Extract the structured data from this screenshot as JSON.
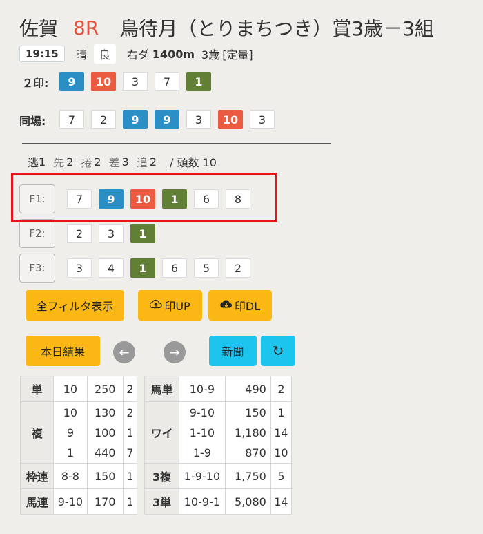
{
  "race": {
    "venue": "佐賀",
    "race_no": "8R",
    "name": "鳥待月（とりまちつき）賞3歳－3組",
    "time": "19:15",
    "weather": "晴",
    "condition": "良",
    "course": "右ダ",
    "distance": "1400m",
    "age": "3歳",
    "weight_rule": "[定量]"
  },
  "marks": {
    "label": "２印:",
    "numbers": [
      {
        "n": "9",
        "c": "blue"
      },
      {
        "n": "10",
        "c": "red"
      },
      {
        "n": "3",
        "c": "white"
      },
      {
        "n": "7",
        "c": "white"
      },
      {
        "n": "1",
        "c": "green"
      }
    ]
  },
  "same_venue": {
    "label": "同場:",
    "numbers": [
      {
        "n": "7",
        "c": "white"
      },
      {
        "n": "2",
        "c": "white"
      },
      {
        "n": "9",
        "c": "blue"
      },
      {
        "n": "9",
        "c": "blue"
      },
      {
        "n": "3",
        "c": "white"
      },
      {
        "n": "10",
        "c": "red"
      },
      {
        "n": "3",
        "c": "white"
      }
    ]
  },
  "running_style": {
    "nige_k": "逃",
    "nige_v": "1",
    "senko_k": "先",
    "senko_v": "2",
    "makuri_k": "捲",
    "makuri_v": "2",
    "sashi_k": "差",
    "sashi_v": "3",
    "oikomi_k": "追",
    "oikomi_v": "2",
    "count": "/ 頭数 10"
  },
  "filters": [
    {
      "label": "F1:",
      "numbers": [
        {
          "n": "7",
          "c": "white"
        },
        {
          "n": "9",
          "c": "blue"
        },
        {
          "n": "10",
          "c": "red"
        },
        {
          "n": "1",
          "c": "green"
        },
        {
          "n": "6",
          "c": "white"
        },
        {
          "n": "8",
          "c": "white"
        }
      ]
    },
    {
      "label": "F2:",
      "numbers": [
        {
          "n": "2",
          "c": "white"
        },
        {
          "n": "3",
          "c": "white"
        },
        {
          "n": "1",
          "c": "green"
        }
      ]
    },
    {
      "label": "F3:",
      "numbers": [
        {
          "n": "3",
          "c": "white"
        },
        {
          "n": "4",
          "c": "white"
        },
        {
          "n": "1",
          "c": "green"
        },
        {
          "n": "6",
          "c": "white"
        },
        {
          "n": "5",
          "c": "white"
        },
        {
          "n": "2",
          "c": "white"
        }
      ]
    }
  ],
  "buttons": {
    "show_all": "全フィルタ表示",
    "upload": "印UP",
    "upload_icon": "cloud-upload-icon",
    "download": "印DL",
    "download_icon": "cloud-download-icon",
    "results": "本日結果",
    "prev_icon": "←",
    "next_icon": "→",
    "newspaper": "新聞",
    "refresh_icon": "↻"
  },
  "payouts": {
    "left": [
      {
        "type": "単",
        "lines": [
          {
            "c": "10",
            "p": "250",
            "r": "2"
          }
        ]
      },
      {
        "type": "複",
        "lines": [
          {
            "c": "10",
            "p": "130",
            "r": "2"
          },
          {
            "c": "9",
            "p": "100",
            "r": "1"
          },
          {
            "c": "1",
            "p": "440",
            "r": "7"
          }
        ]
      },
      {
        "type": "枠連",
        "lines": [
          {
            "c": "8-8",
            "p": "150",
            "r": "1"
          }
        ]
      },
      {
        "type": "馬連",
        "lines": [
          {
            "c": "9-10",
            "p": "170",
            "r": "1"
          }
        ]
      }
    ],
    "right": [
      {
        "type": "馬単",
        "lines": [
          {
            "c": "10-9",
            "p": "490",
            "r": "2"
          }
        ]
      },
      {
        "type": "ワイ",
        "lines": [
          {
            "c": "9-10",
            "p": "150",
            "r": "1"
          },
          {
            "c": "1-10",
            "p": "1,180",
            "r": "14"
          },
          {
            "c": "1-9",
            "p": "870",
            "r": "10"
          }
        ]
      },
      {
        "type": "3複",
        "lines": [
          {
            "c": "1-9-10",
            "p": "1,750",
            "r": "5"
          }
        ]
      },
      {
        "type": "3単",
        "lines": [
          {
            "c": "10-9-1",
            "p": "5,080",
            "r": "14"
          }
        ]
      }
    ]
  }
}
